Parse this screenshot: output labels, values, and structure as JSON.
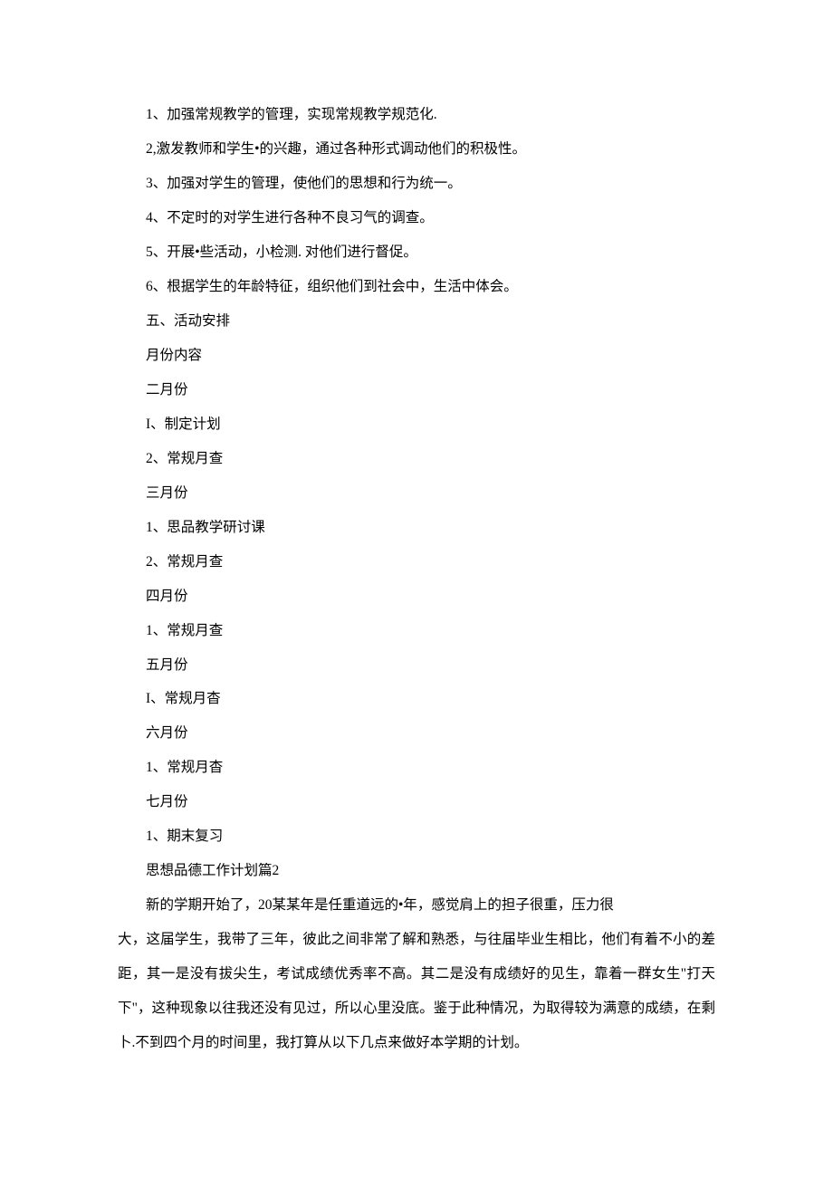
{
  "lines": [
    "1、加强常规教学的管理，实现常规教学规范化.",
    "2,激发教师和学生•的兴趣，通过各种形式调动他们的积极性。",
    "3、加强对学生的管理，使他们的思想和行为统一。",
    "4、不定时的对学生进行各种不良习气的调查。",
    "5、开展•些活动，小检测. 对他们进行督促。",
    "6、根据学生的年龄特征，组织他们到社会中，生活中体会。",
    "五、活动安排",
    "月份内容",
    "二月份",
    "I、制定计划",
    "2、常规月查",
    "三月份",
    "1、思品教学研讨课",
    "2、常规月查",
    "四月份",
    "1、常规月查",
    "五月份",
    "I、常规月杳",
    "六月份",
    "1、常规月杳",
    "七月份",
    "1、期末复习",
    "思想品德工作计划篇2"
  ],
  "paragraph": {
    "indent_start": "新的学期开始了，20某某年是任重道远的•年，感觉肩上的担子很重，压力很",
    "rest": "大，这届学生，我带了三年，彼此之间非常了解和熟悉，与往届毕业生相比，他们有着不小的差距，其一是没有拔尖生，考试成绩优秀率不高。其二是没有成绩好的见生，靠着一群女生\"打天下\"，这种现象以往我还没有见过，所以心里没底。鉴于此种情况，为取得较为满意的成绩，在剩卜.不到四个月的时间里，我打算从以下几点来做好本学期的计划。"
  }
}
